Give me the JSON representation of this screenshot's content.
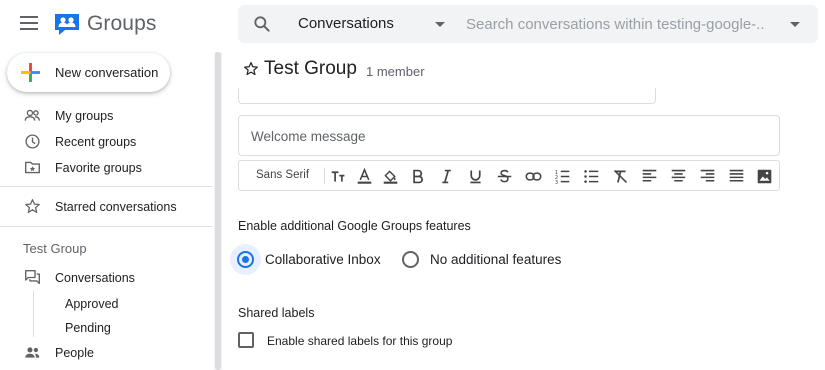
{
  "app": {
    "name": "Groups"
  },
  "search": {
    "scope": "Conversations",
    "placeholder": "Search conversations within testing-google-..."
  },
  "sidebar": {
    "new_conversation": "New conversation",
    "primary": [
      {
        "label": "My groups",
        "icon": "people-icon"
      },
      {
        "label": "Recent groups",
        "icon": "clock-icon"
      },
      {
        "label": "Favorite groups",
        "icon": "folder-star-icon"
      }
    ],
    "starred": {
      "label": "Starred conversations",
      "icon": "star-outline-icon"
    },
    "group_section": {
      "title": "Test Group",
      "conversations": "Conversations",
      "sub_items": [
        "Approved",
        "Pending"
      ],
      "people": "People"
    }
  },
  "main": {
    "group_title": "Test Group",
    "member_count": "1 member",
    "welcome_label": "Welcome message",
    "toolbar": {
      "font": "Sans Serif",
      "buttons": [
        "text-size-icon",
        "text-color-icon",
        "highlight-icon",
        "bold-icon",
        "italic-icon",
        "underline-icon",
        "strikethrough-icon",
        "link-icon",
        "numbered-list-icon",
        "bulleted-list-icon",
        "clear-format-icon",
        "align-left-icon",
        "align-center-icon",
        "align-right-icon",
        "justify-icon",
        "image-icon"
      ]
    },
    "features": {
      "title": "Enable additional Google Groups features",
      "options": [
        {
          "label": "Collaborative Inbox",
          "selected": true
        },
        {
          "label": "No additional features",
          "selected": false
        }
      ]
    },
    "shared_labels": {
      "title": "Shared labels",
      "checkbox_label": "Enable shared labels for this group",
      "checked": false
    }
  },
  "colors": {
    "accent": "#1a73e8",
    "text": "#202124",
    "muted": "#5f6368",
    "border": "#dadce0"
  }
}
